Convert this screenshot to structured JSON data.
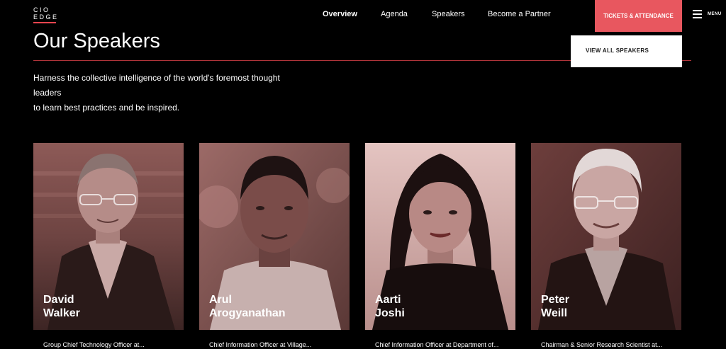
{
  "logo": {
    "line1": "CIO",
    "line2": "EDGE"
  },
  "nav": {
    "items": [
      {
        "label": "Overview",
        "active": true
      },
      {
        "label": "Agenda",
        "active": false
      },
      {
        "label": "Speakers",
        "active": false
      },
      {
        "label": "Become a Partner",
        "active": false
      }
    ],
    "cta_label": "TICKETS & ATTENDANCE",
    "menu_label": "MENU"
  },
  "dropdown": {
    "item_label": "VIEW ALL SPEAKERS"
  },
  "page": {
    "title": "Our Speakers",
    "intro_line1": "Harness the collective intelligence of the world's foremost thought leaders",
    "intro_line2": "to learn best practices and be inspired."
  },
  "speakers": [
    {
      "first": "David",
      "last": "Walker",
      "role": "Group Chief Technology Officer at..."
    },
    {
      "first": "Arul",
      "last": "Arogyanathan",
      "role": "Chief Information Officer at Village..."
    },
    {
      "first": "Aarti",
      "last": "Joshi",
      "role": "Chief Information Officer at Department of..."
    },
    {
      "first": "Peter",
      "last": "Weill",
      "role": "Chairman & Senior Research Scientist at..."
    }
  ],
  "colors": {
    "accent": "#e8575f",
    "rule": "#b1343a",
    "photo_tint": "#7a4846"
  }
}
